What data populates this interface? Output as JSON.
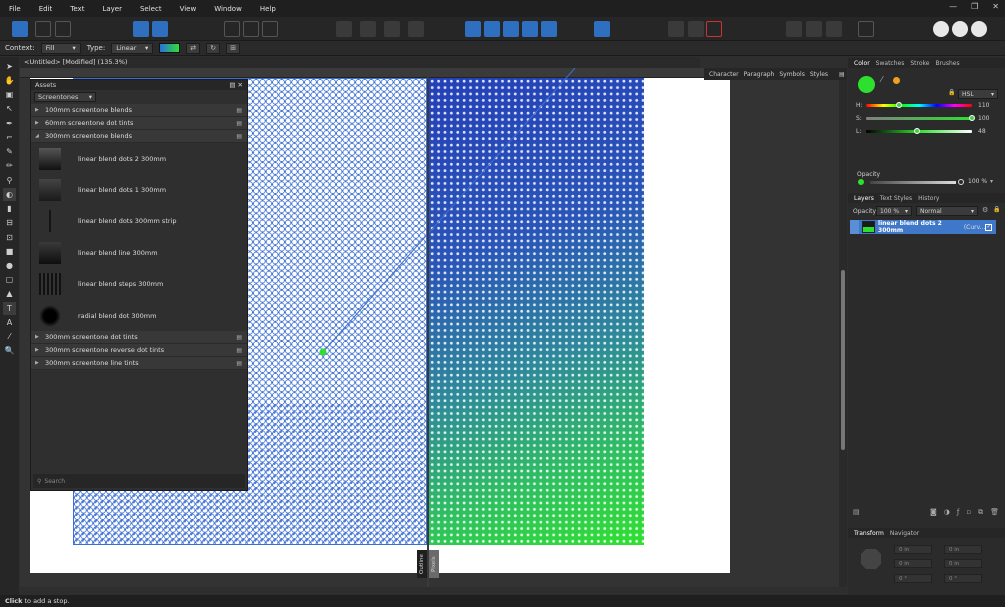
{
  "menubar": {
    "items": [
      "File",
      "Edit",
      "Text",
      "Layer",
      "Select",
      "View",
      "Window",
      "Help"
    ],
    "window_controls": [
      "—",
      "❐",
      "✕"
    ]
  },
  "context_bar": {
    "context_label": "Context:",
    "context_value": "Fill",
    "type_label": "Type:",
    "type_value": "Linear"
  },
  "document": {
    "tab_title": "<Untitled> [Modified] (135.3%)",
    "split_view_labels": [
      "Outline",
      "Pixels"
    ]
  },
  "text_panels": {
    "tabs": [
      "Character",
      "Paragraph",
      "Symbols",
      "Styles"
    ]
  },
  "assets": {
    "panel_title": "Assets",
    "category": "Screentones",
    "groups_before": [
      "100mm screentone blends",
      "60mm screentone dot tints"
    ],
    "open_group": "300mm screentone blends",
    "items": [
      "linear blend dots 2 300mm",
      "linear blend dots 1 300mm",
      "linear blend dots 300mm strip",
      "linear blend line 300mm",
      "linear blend steps 300mm",
      "radial blend dot 300mm"
    ],
    "groups_after": [
      "300mm screentone dot tints",
      "300mm screentone reverse dot tints",
      "300mm screentone line tints"
    ],
    "search_placeholder": "Search"
  },
  "color_panel": {
    "tabs": [
      "Color",
      "Swatches",
      "Stroke",
      "Brushes"
    ],
    "model": "HSL",
    "h_label": "H:",
    "h_value": "110",
    "s_label": "S:",
    "s_value": "100",
    "l_label": "L:",
    "l_value": "48",
    "h_fraction": 0.31,
    "s_fraction": 1.0,
    "l_fraction": 0.48,
    "opacity_label": "Opacity",
    "opacity_value": "100 %",
    "current_color": "#2ee02e",
    "secondary_color": "#f0a020"
  },
  "layers_panel": {
    "tabs": [
      "Layers",
      "Text Styles",
      "History"
    ],
    "opacity_label": "Opacity:",
    "opacity_value": "100 %",
    "blend_mode": "Normal",
    "layer_name": "linear blend dots 2 300mm",
    "layer_type": "(Curv..."
  },
  "transform_panel": {
    "tabs": [
      "Transform",
      "Navigator"
    ],
    "fields": [
      "0 in",
      "0 in",
      "0 in",
      "0 in",
      "0 °",
      "0 °"
    ]
  },
  "status": {
    "bold": "Click",
    "text": " to add a stop."
  },
  "colors": {
    "accent": "#3f78c9",
    "gradient_start": "#2a6ee0",
    "gradient_end": "#2ee02e"
  }
}
